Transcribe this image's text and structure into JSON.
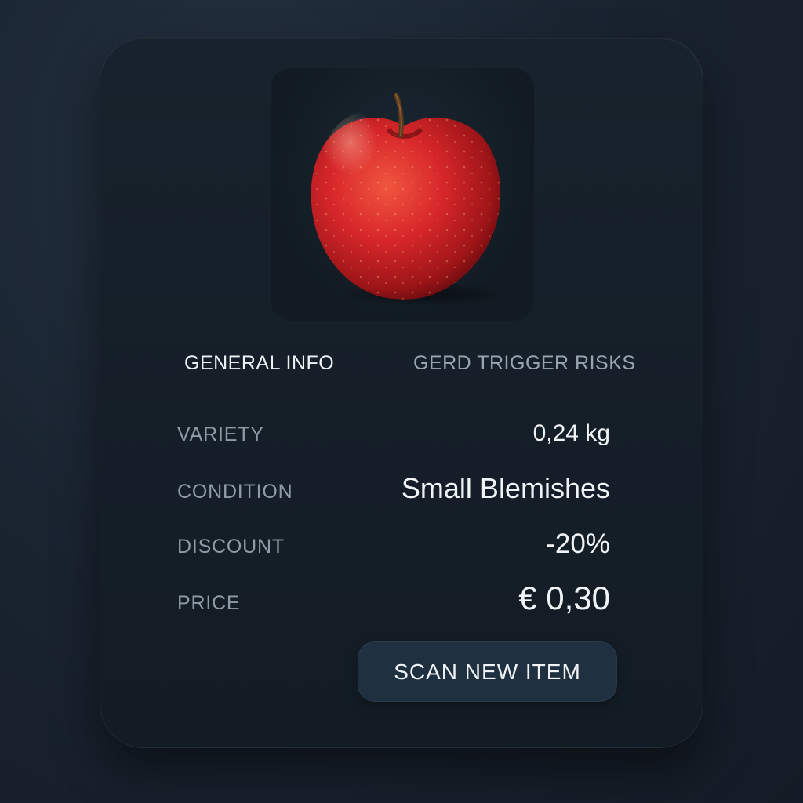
{
  "product": {
    "image_icon": "apple-photo",
    "image_alt": "Red apple"
  },
  "tabs": [
    {
      "label": "GENERAL INFO",
      "active": true
    },
    {
      "label": "GERD TRIGGER RISKS",
      "active": false
    }
  ],
  "details": {
    "variety": {
      "label": "VARIETY",
      "value": "0,24 kg"
    },
    "condition": {
      "label": "CONDITION",
      "value": "Small Blemishes"
    },
    "discount": {
      "label": "DISCOUNT",
      "value": "-20%"
    },
    "price": {
      "label": "PRICE",
      "value": "€ 0,30"
    }
  },
  "actions": {
    "scan_label": "SCAN NEW ITEM"
  },
  "colors": {
    "background": "#1a2431",
    "card": "#151e27",
    "button": "#1f3040",
    "apple_red": "#d4262a",
    "text_primary": "#f1f4f7",
    "text_muted": "#8f9ba6"
  }
}
